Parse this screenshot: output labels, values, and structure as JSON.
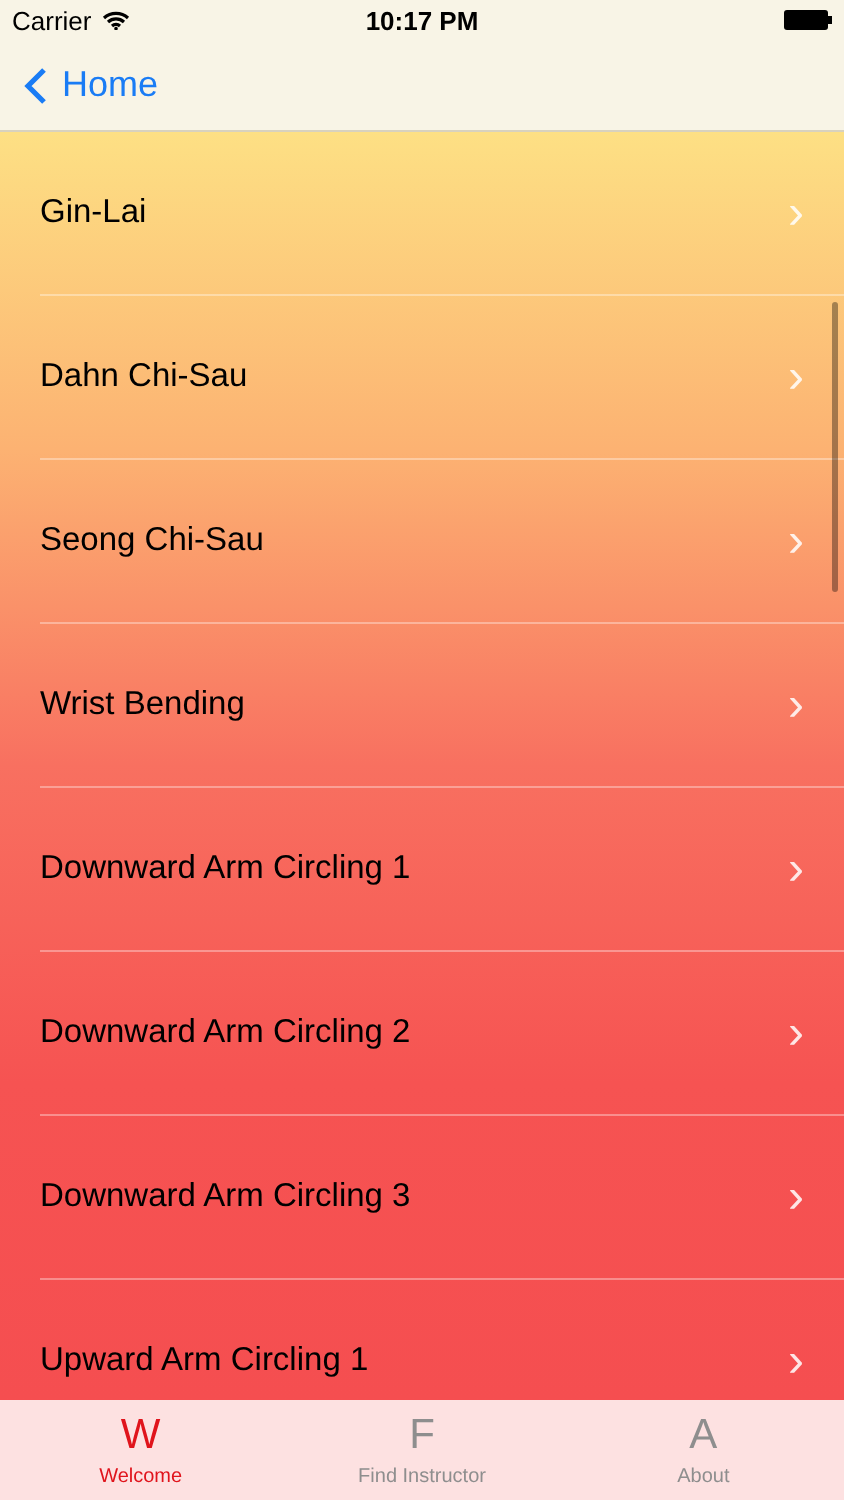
{
  "status_bar": {
    "carrier": "Carrier",
    "time": "10:17 PM"
  },
  "nav_bar": {
    "back": "Home"
  },
  "list": {
    "items": [
      {
        "label": "Gin-Lai",
        "chevron": "›"
      },
      {
        "label": "Dahn Chi-Sau",
        "chevron": "›"
      },
      {
        "label": "Seong Chi-Sau",
        "chevron": "›"
      },
      {
        "label": "Wrist Bending",
        "chevron": "›"
      },
      {
        "label": "Downward Arm Circling 1",
        "chevron": "›"
      },
      {
        "label": "Downward Arm Circling 2",
        "chevron": "›"
      },
      {
        "label": "Downward Arm Circling 3",
        "chevron": "›"
      },
      {
        "label": "Upward Arm Circling 1",
        "chevron": "›"
      }
    ]
  },
  "tab_bar": {
    "tabs": [
      {
        "glyph": "W",
        "label": "Welcome",
        "selected": true
      },
      {
        "glyph": "F",
        "label": "Find Instructor",
        "selected": false
      },
      {
        "glyph": "A",
        "label": "About",
        "selected": false
      }
    ]
  }
}
